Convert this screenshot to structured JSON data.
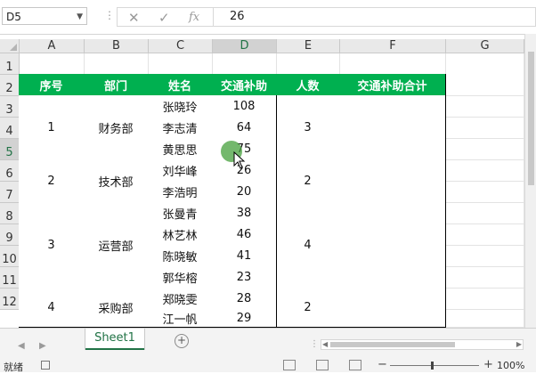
{
  "formula_bar": {
    "name_box": "D5",
    "value": "26",
    "cancel_icon": "close-icon",
    "enter_icon": "check-icon",
    "fx_label": "fx"
  },
  "columns": [
    "A",
    "B",
    "C",
    "D",
    "E",
    "F",
    "G"
  ],
  "rows": [
    "1",
    "2",
    "3",
    "4",
    "5",
    "6",
    "7",
    "8",
    "9",
    "10",
    "11",
    "12"
  ],
  "table": {
    "headers": [
      "序号",
      "部门",
      "姓名",
      "交通补助",
      "人数",
      "交通补助合计"
    ],
    "groups": [
      {
        "id": "1",
        "dept": "财务部",
        "count": "3",
        "total": ""
      },
      {
        "id": "2",
        "dept": "技术部",
        "count": "2",
        "total": ""
      },
      {
        "id": "3",
        "dept": "运营部",
        "count": "4",
        "total": ""
      },
      {
        "id": "4",
        "dept": "采购部",
        "count": "2",
        "total": ""
      }
    ],
    "people": [
      {
        "name": "张晓玲",
        "subsidy": "108"
      },
      {
        "name": "李志清",
        "subsidy": "64"
      },
      {
        "name": "黄思思",
        "subsidy": "75"
      },
      {
        "name": "刘华峰",
        "subsidy": "26"
      },
      {
        "name": "李浩明",
        "subsidy": "20"
      },
      {
        "name": "张曼青",
        "subsidy": "38"
      },
      {
        "name": "林艺林",
        "subsidy": "46"
      },
      {
        "name": "陈晓敏",
        "subsidy": "41"
      },
      {
        "name": "郭华榕",
        "subsidy": "23"
      },
      {
        "name": "郑晓雯",
        "subsidy": "28"
      },
      {
        "name": "江一帆",
        "subsidy": "29"
      }
    ]
  },
  "sheet_tabs": [
    "Sheet1"
  ],
  "status": {
    "ready": "就绪",
    "zoom": "100%"
  },
  "colors": {
    "header_fill": "#00b050",
    "accent": "#217346"
  }
}
